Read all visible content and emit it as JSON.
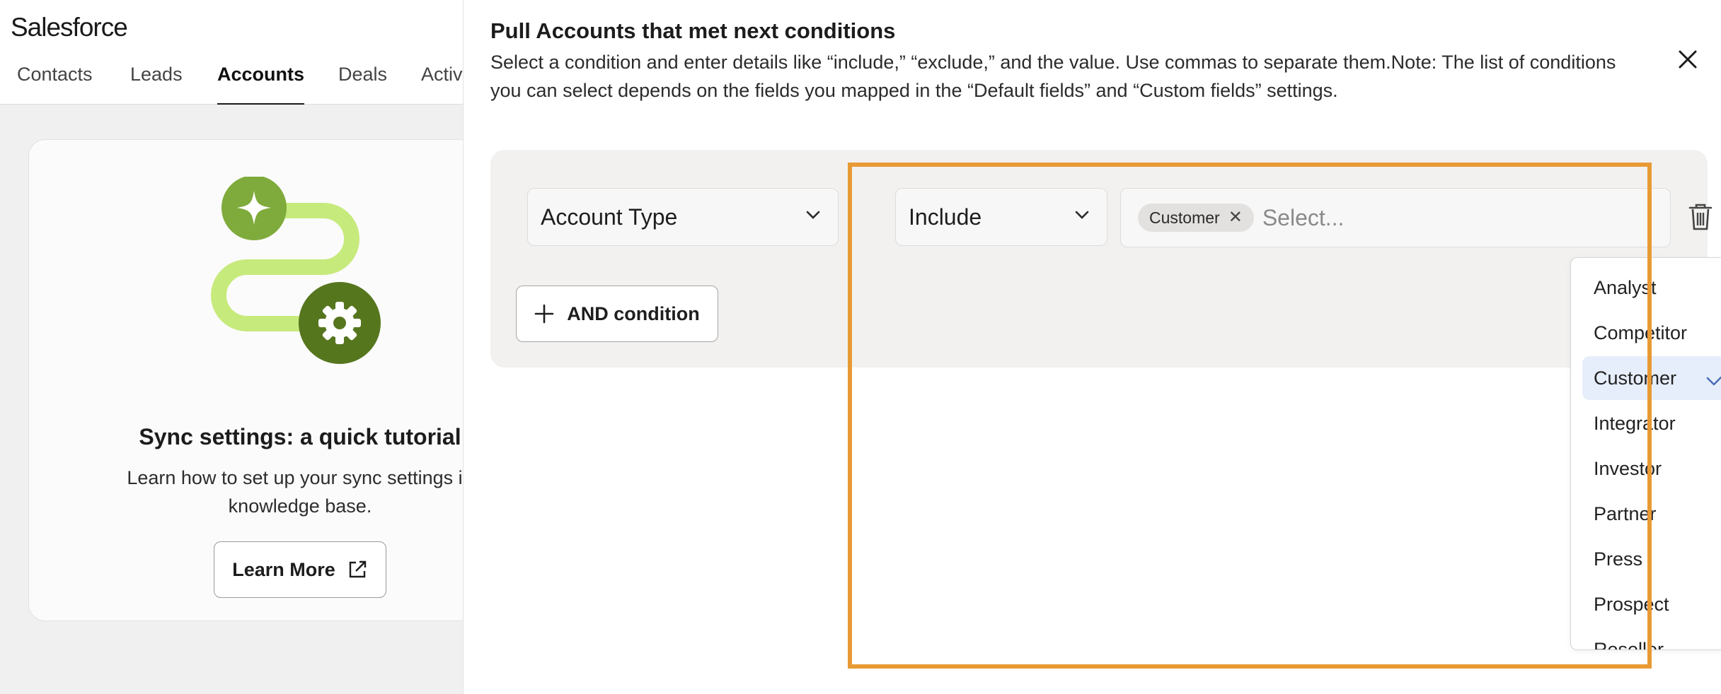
{
  "app": {
    "brand": "Salesforce"
  },
  "tabs": [
    {
      "label": "Contacts"
    },
    {
      "label": "Leads"
    },
    {
      "label": "Accounts",
      "active": true
    },
    {
      "label": "Deals"
    },
    {
      "label": "Activ"
    }
  ],
  "tutorial": {
    "title": "Sync settings: a quick tutorial",
    "desc_line1": "Learn how to set up your sync settings in",
    "desc_line2": "knowledge base.",
    "button_label": "Learn More"
  },
  "panel": {
    "title": "Pull Accounts that met next conditions",
    "desc_line1": "Select a condition and enter details like “include,” “exclude,” and the value. Use commas to separate them.Note: The list of conditions",
    "desc_line2": "you can select depends on the fields you mapped in the “Default fields” and “Custom fields” settings."
  },
  "condition": {
    "field": "Account Type",
    "operator": "Include",
    "chips": [
      "Customer"
    ],
    "value_placeholder": "Select...",
    "and_button_label": "AND condition"
  },
  "dropdown": {
    "options": [
      "Analyst",
      "Competitor",
      "Customer",
      "Integrator",
      "Investor",
      "Partner",
      "Press",
      "Prospect",
      "Reseller"
    ],
    "selected": "Customer"
  },
  "colors": {
    "highlight": "#e89a35",
    "selected_bg": "#e7eefb",
    "check": "#4a6fb5",
    "illustration_light": "#c7ea7c",
    "illustration_mid": "#7fab3c",
    "illustration_dark": "#56761e"
  },
  "icons": [
    "close-icon",
    "chevron-down-icon",
    "trash-icon",
    "plus-icon",
    "external-link-icon",
    "check-icon",
    "sparkle-icon",
    "gear-icon"
  ]
}
